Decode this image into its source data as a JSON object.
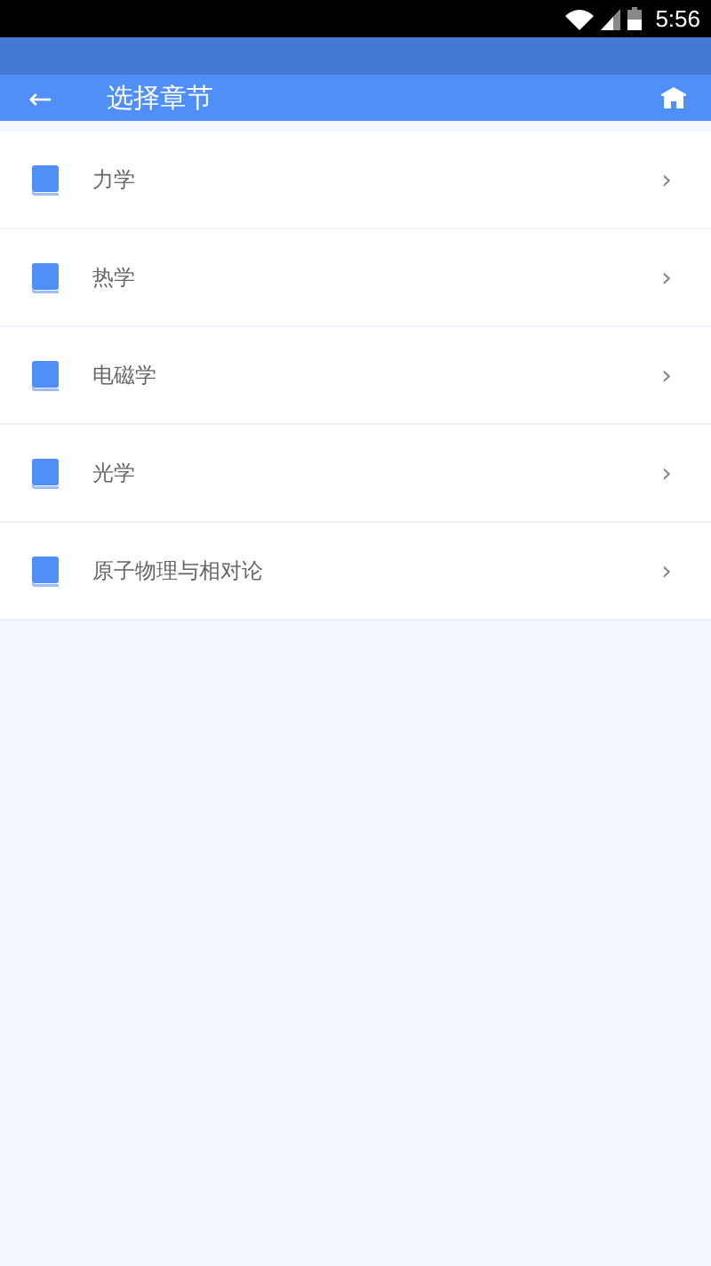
{
  "status_bar": {
    "time": "5:56"
  },
  "header": {
    "title": "选择章节",
    "back": "←"
  },
  "chapters": [
    {
      "title": "力学",
      "chevron": "›"
    },
    {
      "title": "热学",
      "chevron": "›"
    },
    {
      "title": "电磁学",
      "chevron": "›"
    },
    {
      "title": "光学",
      "chevron": "›"
    },
    {
      "title": "原子物理与相对论",
      "chevron": "›"
    }
  ]
}
